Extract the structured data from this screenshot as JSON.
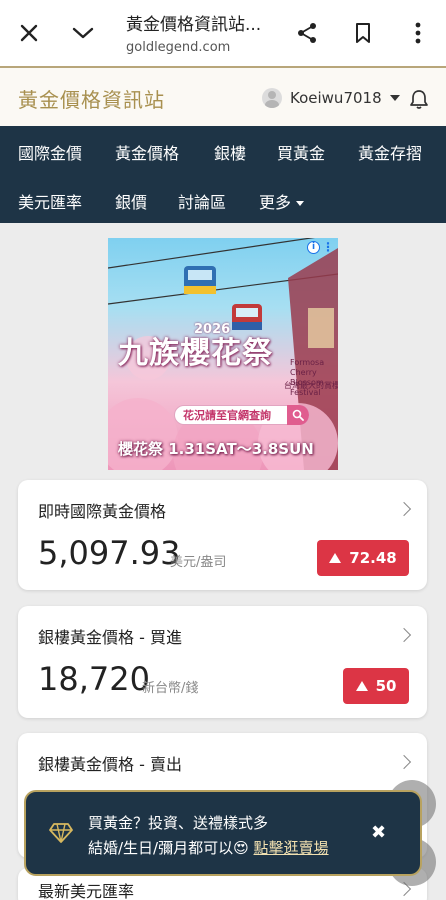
{
  "browser": {
    "page_title": "黃金價格資訊站...",
    "url": "goldlegend.com"
  },
  "site": {
    "logo": "黃金價格資訊站",
    "username": "Koeiwu7018"
  },
  "nav": {
    "row1": [
      "國際金價",
      "黃金價格",
      "銀樓",
      "買黃金",
      "黃金存摺"
    ],
    "row2": [
      "美元匯率",
      "銀價",
      "討論區",
      "更多"
    ]
  },
  "ad": {
    "year": "2026",
    "title": "九族櫻花祭",
    "subtitle_en": "Formosa Cherry Blossom Festival",
    "subtitle_zh": "台灣最大的賞櫻勝地",
    "button": "花況請至官網查詢",
    "dates": "櫻花祭 1.31SAT～3.8SUN"
  },
  "cards": [
    {
      "title": "即時國際黃金價格",
      "value": "5,097.93",
      "unit": "美元/盎司",
      "change": "72.48"
    },
    {
      "title": "銀樓黃金價格 - 買進",
      "value": "18,720",
      "unit": "新台幣/錢",
      "change": "50"
    },
    {
      "title": "銀樓黃金價格 - 賣出"
    },
    {
      "title": "最新美元匯率"
    }
  ],
  "toast": {
    "line1": "買黃金？投資、送禮樣式多",
    "line2_prefix": "結婚/生日/彌月都可以😍 ",
    "link": "點擊逛賣場",
    "close": "✖"
  },
  "colors": {
    "nav_bg": "#1e3446",
    "logo_gold": "#a8904f",
    "change_red": "#dc3545",
    "toast_border": "#b8a25f"
  },
  "icons": {
    "close": "close-icon",
    "collapse": "chevron-down-icon",
    "share": "share-icon",
    "bookmark": "bookmark-icon",
    "more": "more-vert-icon",
    "notifications": "bell-icon",
    "gem": "diamond-icon"
  }
}
